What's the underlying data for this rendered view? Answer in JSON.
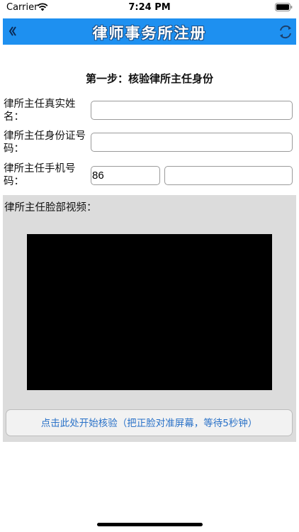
{
  "status_bar": {
    "carrier": "Carrier",
    "time": "7:24 PM"
  },
  "nav": {
    "title": "律师事务所注册",
    "back_icon": "chevron-double-left-icon",
    "refresh_icon": "refresh-icon",
    "color": "#1e90f0"
  },
  "form": {
    "step_title": "第一步：核验律所主任身份",
    "name": {
      "label": "律所主任真实姓名：",
      "value": ""
    },
    "id_number": {
      "label": "律所主任身份证号码：",
      "value": ""
    },
    "phone": {
      "label": "律所主任手机号码：",
      "country_code": "86",
      "value": ""
    },
    "video": {
      "label": "律所主任脸部视频：",
      "button_label": "点击此处开始核验（把正脸对准屏幕，等待5秒钟）"
    }
  }
}
